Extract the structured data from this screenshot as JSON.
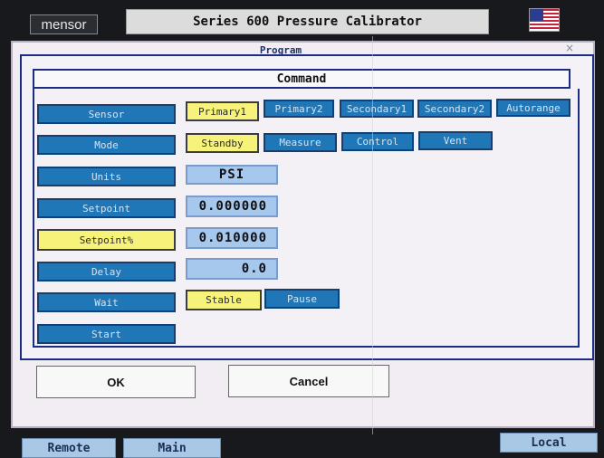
{
  "brand": "mensor",
  "title": "Series 600 Pressure Calibrator",
  "flag_icon": "us-flag-icon",
  "window": {
    "background_title": "Program",
    "close_glyph": "×"
  },
  "command": {
    "heading": "Command",
    "rows": {
      "sensor": {
        "label": "Sensor",
        "options": [
          "Primary1",
          "Primary2",
          "Secondary1",
          "Secondary2",
          "Autorange"
        ],
        "selected": "Primary1"
      },
      "mode": {
        "label": "Mode",
        "options": [
          "Standby",
          "Measure",
          "Control",
          "Vent"
        ],
        "selected": "Standby"
      },
      "units": {
        "label": "Units",
        "value": "PSI"
      },
      "setpoint": {
        "label": "Setpoint",
        "value": "0.000000"
      },
      "setpoint_pct": {
        "label": "Setpoint%",
        "value": "0.010000"
      },
      "delay": {
        "label": "Delay",
        "value": "0.0"
      },
      "wait": {
        "label": "Wait",
        "options": [
          "Stable",
          "Pause"
        ],
        "selected": "Stable"
      },
      "start": {
        "label": "Start"
      }
    },
    "ok_label": "OK",
    "cancel_label": "Cancel"
  },
  "footer": {
    "remote": "Remote",
    "main": "Main",
    "local": "Local"
  },
  "colors": {
    "button_blue": "#1f77b8",
    "selected_yellow": "#f7f27a",
    "value_blue": "#a6c8ec",
    "frame_navy": "#1a2c84"
  }
}
